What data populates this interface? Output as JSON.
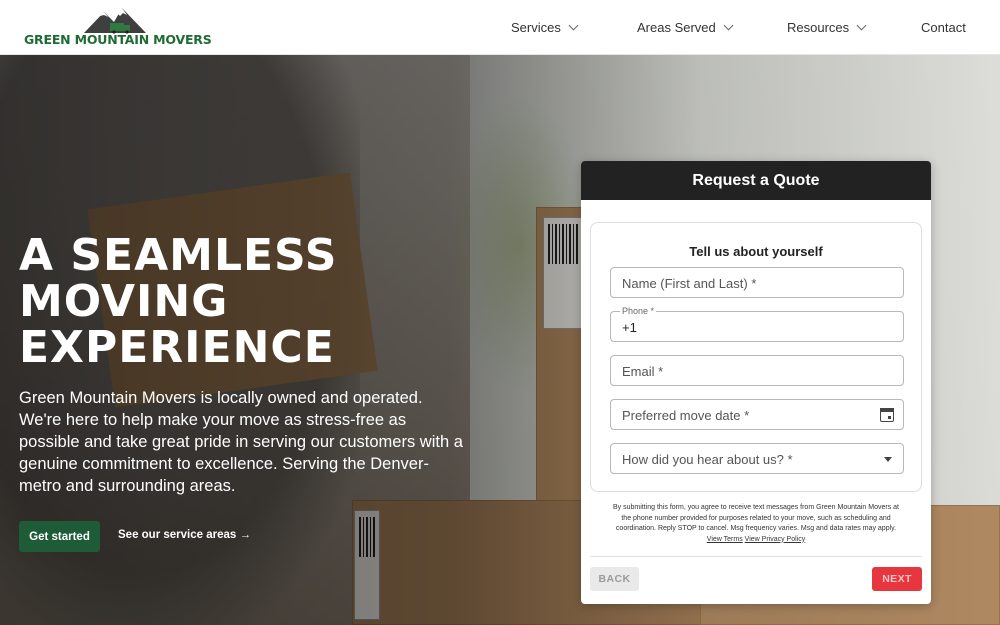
{
  "header": {
    "logo_text": "GREEN MOUNTAIN MOVERS",
    "nav": [
      {
        "label": "Services",
        "has_dropdown": true
      },
      {
        "label": "Areas Served",
        "has_dropdown": true
      },
      {
        "label": "Resources",
        "has_dropdown": true
      },
      {
        "label": "Contact",
        "has_dropdown": false
      }
    ]
  },
  "hero": {
    "headline": [
      "A SEAMLESS",
      "MOVING",
      "EXPERIENCE"
    ],
    "intro": "Green Mountain Movers is locally owned and operated. We're here to help make your move as stress-free as possible and take great pride in serving our customers with a genuine commitment to excellence. Serving the Denver-metro and surrounding areas.",
    "cta_primary": "Get started",
    "cta_secondary": "See our service areas →"
  },
  "quote_form": {
    "title": "Request a Quote",
    "section_title": "Tell us about yourself",
    "fields": {
      "name_placeholder": "Name (First and Last) *",
      "phone_label": "Phone *",
      "phone_value": "+1",
      "email_placeholder": "Email *",
      "date_placeholder": "Preferred move date *",
      "source_placeholder": "How did you hear about us? *"
    },
    "disclaimer": "By submitting this form, you agree to receive text messages from Green Mountain Movers at the phone number provided for purposes related to your move, such as scheduling and coordination. Reply STOP to cancel. Msg frequency varies. Msg and data rates may apply.",
    "terms_link": "View Terms",
    "privacy_link": "View Privacy Policy",
    "back_label": "BACK",
    "next_label": "NEXT"
  },
  "colors": {
    "brand_green": "#1f6b34",
    "cta_green": "#1d5c37",
    "next_red": "#e8363f",
    "quote_header": "#222222"
  },
  "icons": [
    "mountain-truck-logo-icon",
    "chevron-down-icon",
    "calendar-icon",
    "dropdown-arrow-icon"
  ]
}
